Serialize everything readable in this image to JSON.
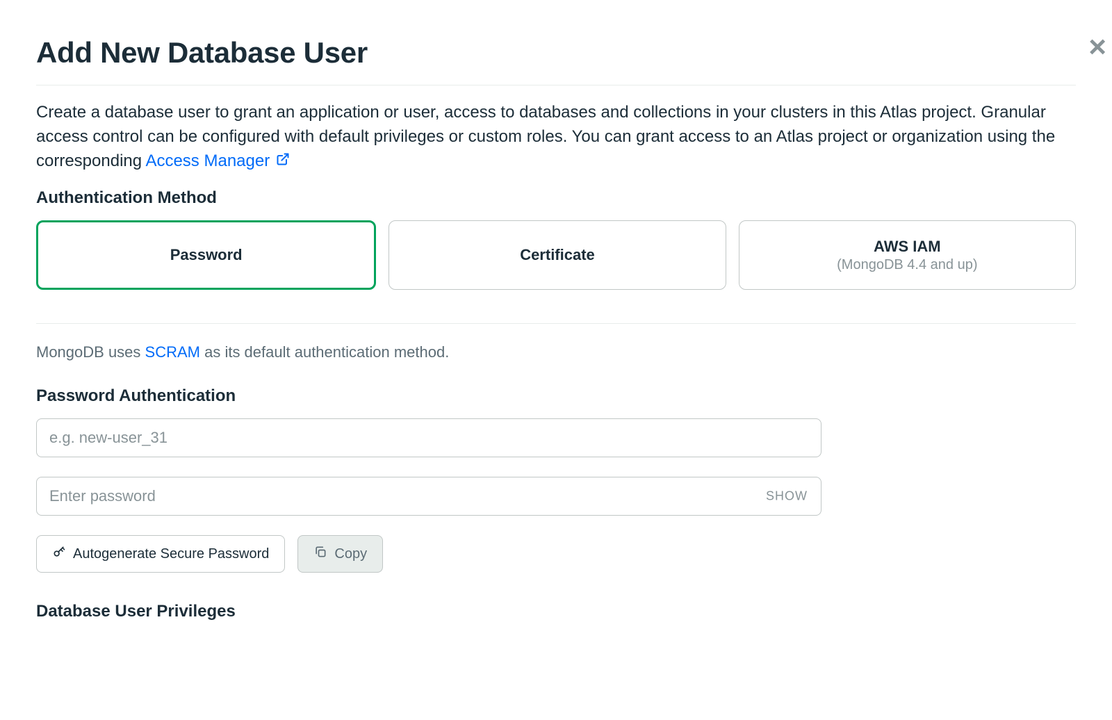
{
  "modal": {
    "close_label": "×",
    "title": "Add New Database User",
    "description_pre": "Create a database user to grant an application or user, access to databases and collections in your clusters in this Atlas project. Granular access control can be configured with default privileges or custom roles. You can grant access to an Atlas project or organization using the corresponding ",
    "access_manager_link": "Access Manager"
  },
  "auth": {
    "section_label": "Authentication Method",
    "options": [
      {
        "label": "Password",
        "sub": ""
      },
      {
        "label": "Certificate",
        "sub": ""
      },
      {
        "label": "AWS IAM",
        "sub": "(MongoDB 4.4 and up)"
      }
    ]
  },
  "scram": {
    "pre": "MongoDB uses ",
    "link": "SCRAM",
    "post": " as its default authentication method."
  },
  "password_section": {
    "heading": "Password Authentication",
    "username_placeholder": "e.g. new-user_31",
    "password_placeholder": "Enter password",
    "show_label": "SHOW",
    "autogen_label": "Autogenerate Secure Password",
    "copy_label": "Copy"
  },
  "privileges": {
    "heading": "Database User Privileges"
  }
}
